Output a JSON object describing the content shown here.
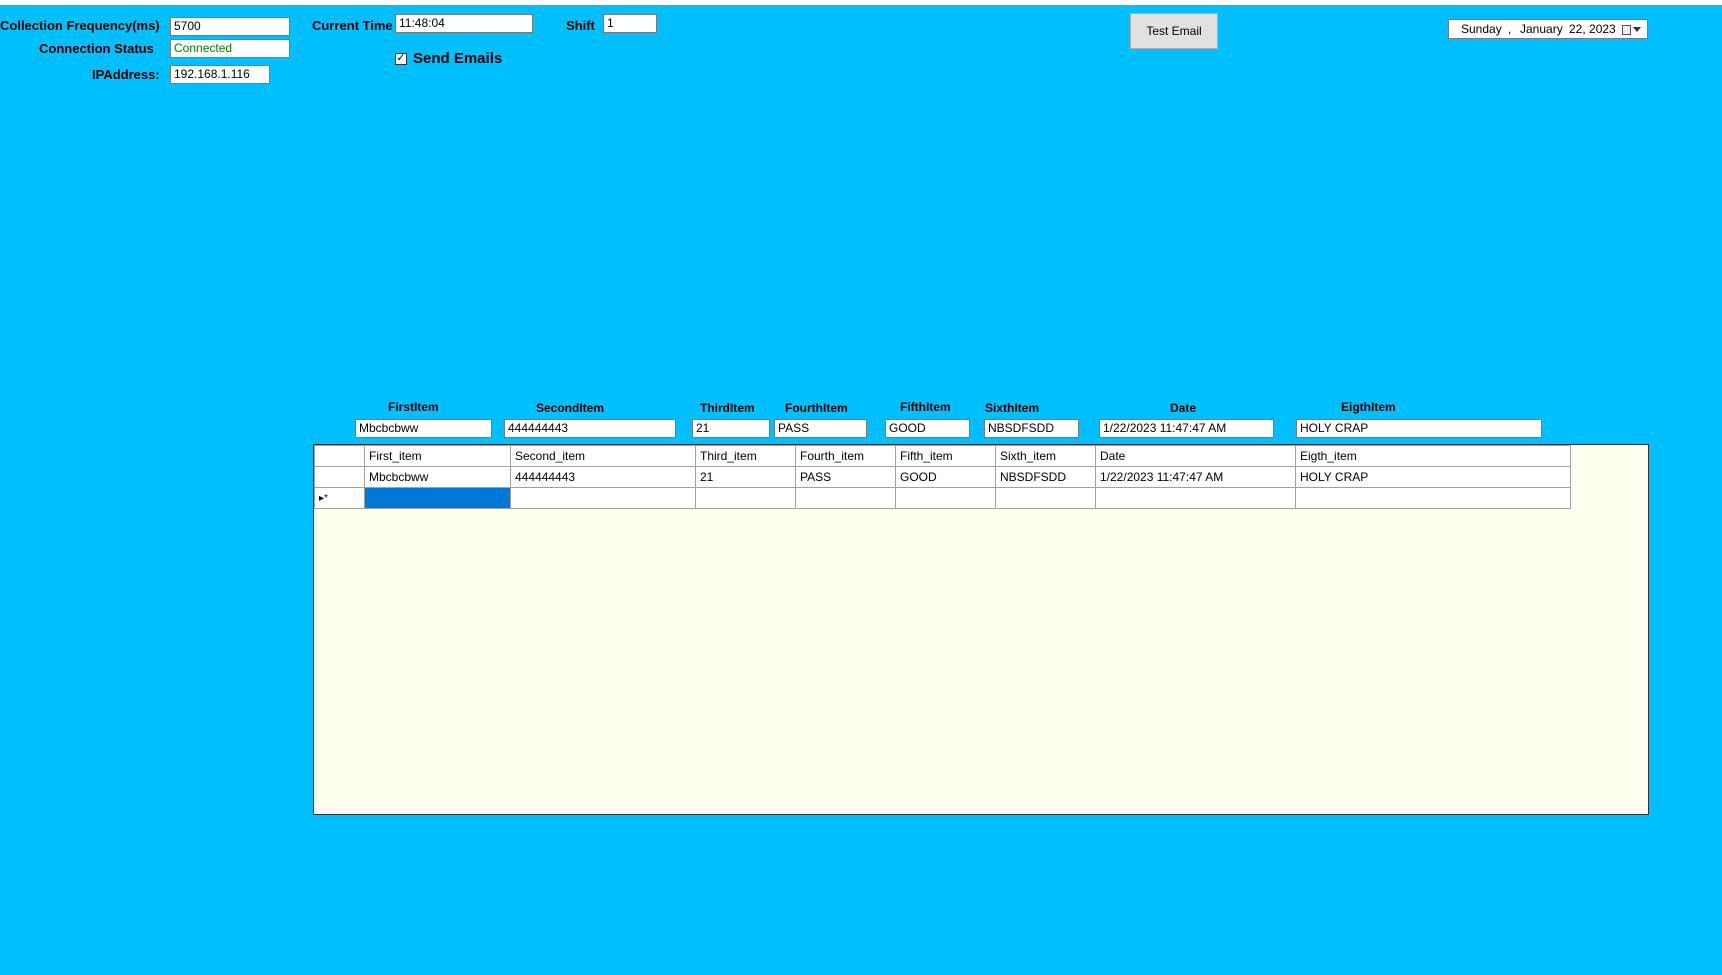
{
  "window": {
    "background_color": "#00BFFF"
  },
  "top_form": {
    "collection_frequency": {
      "label": "Collection Frequency(ms)",
      "value": "5700"
    },
    "connection_status": {
      "label": "Connection Status",
      "value": "Connected",
      "value_color": "#008000"
    },
    "ip_address": {
      "label": "IPAddress:",
      "value": "192.168.1.116"
    },
    "current_time": {
      "label": "Current Time",
      "value": "11:48:04"
    },
    "shift": {
      "label": "Shift",
      "value": "1"
    },
    "send_emails": {
      "label": "Send Emails",
      "checked": true
    },
    "test_email_button": {
      "label": "Test Email"
    },
    "date_picker": {
      "day_name": "Sunday",
      "separator": ",",
      "month": "January",
      "day_year": "22, 2023",
      "icon": "calendar-dropdown-icon"
    }
  },
  "item_fields": [
    {
      "label": "FirstItem",
      "value": "Mbcbcbww"
    },
    {
      "label": "SecondItem",
      "value": "444444443"
    },
    {
      "label": "ThirdItem",
      "value": "21"
    },
    {
      "label": "FourthItem",
      "value": "PASS"
    },
    {
      "label": "FifthItem",
      "value": "GOOD"
    },
    {
      "label": "SixthItem",
      "value": "NBSDFSDD"
    },
    {
      "label": "Date",
      "value": "1/22/2023 11:47:47 AM"
    },
    {
      "label": "EigthItem",
      "value": "HOLY CRAP"
    }
  ],
  "grid": {
    "columns": [
      "First_item",
      "Second_item",
      "Third_item",
      "Fourth_item",
      "Fifth_item",
      "Sixth_item",
      "Date",
      "Eigth_item"
    ],
    "rows": [
      [
        "Mbcbcbww",
        "444444443",
        "21",
        "PASS",
        "GOOD",
        "NBSDFSDD",
        "1/22/2023 11:47:47 AM",
        "HOLY CRAP"
      ]
    ],
    "new_row_marker": "▸*",
    "background_color": "#FFFFF0",
    "selection_color": "#0078D7"
  }
}
